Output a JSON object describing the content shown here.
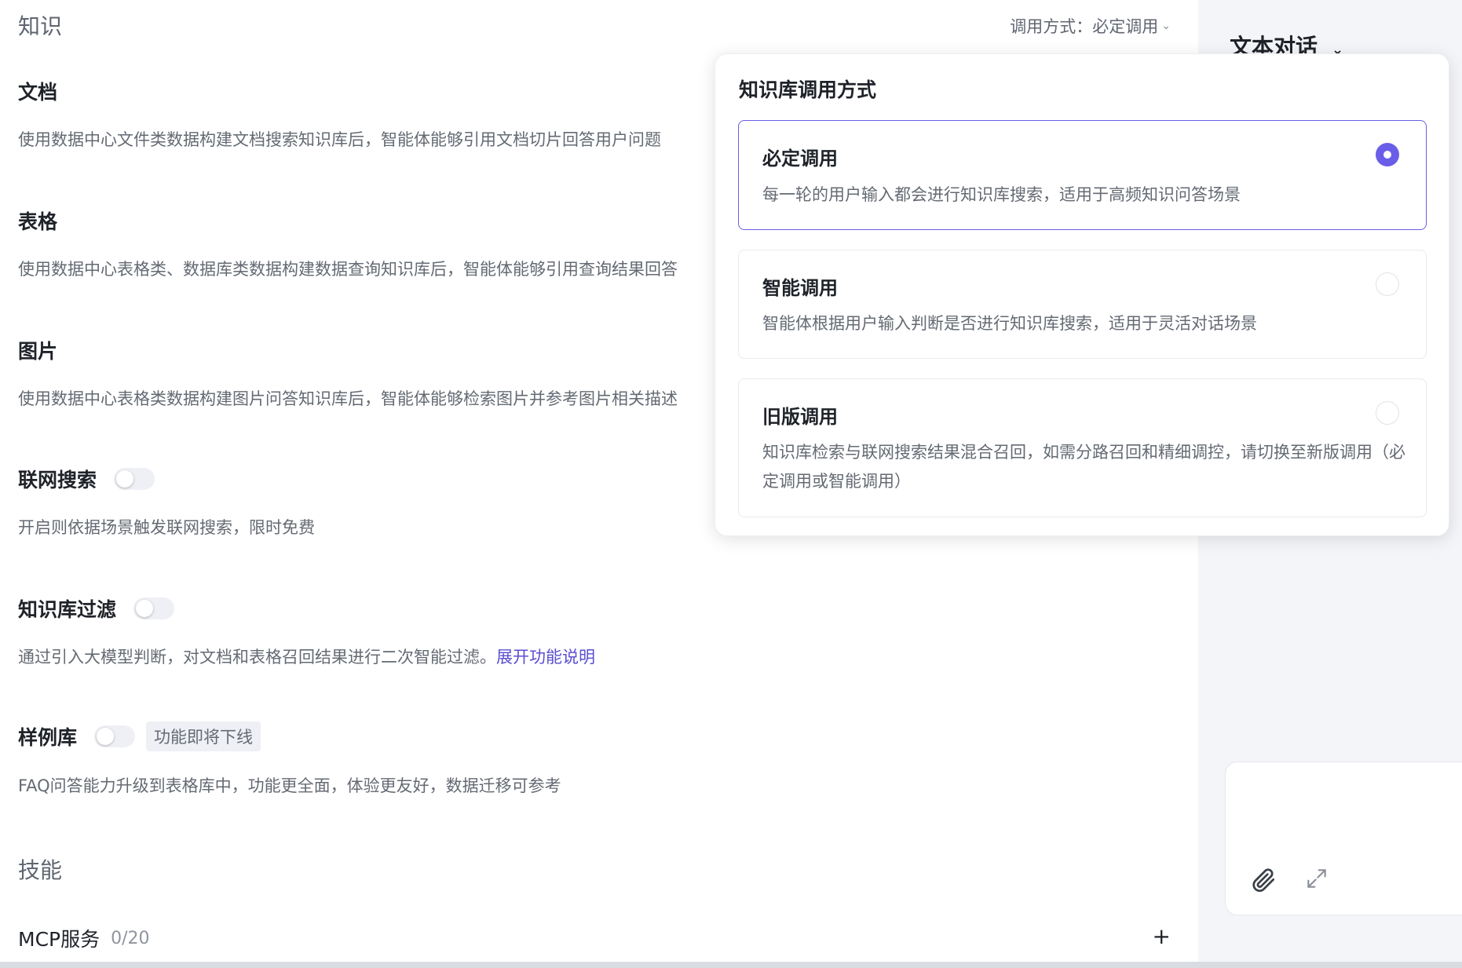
{
  "knowledge": {
    "section_title": "知识",
    "call_mode_label": "调用方式：必定调用",
    "call_mode_chevron": "chevron-down-icon",
    "document": {
      "title": "文档",
      "desc": "使用数据中心文件类数据构建文档搜索知识库后，智能体能够引用文档切片回答用户问题"
    },
    "table": {
      "title": "表格",
      "desc": "使用数据中心表格类、数据库类数据构建数据查询知识库后，智能体能够引用查询结果回答"
    },
    "image": {
      "title": "图片",
      "desc": "使用数据中心表格类数据构建图片问答知识库后，智能体能够检索图片并参考图片相关描述"
    },
    "web_search": {
      "title": "联网搜索",
      "toggle_on": false,
      "desc": "开启则依据场景触发联网搜索，限时免费"
    },
    "kb_filter": {
      "title": "知识库过滤",
      "toggle_on": false,
      "desc": "通过引入大模型判断，对文档和表格召回结果进行二次智能过滤。",
      "link": "展开功能说明"
    },
    "sample_lib": {
      "title": "样例库",
      "toggle_on": false,
      "tag": "功能即将下线",
      "desc": "FAQ问答能力升级到表格库中，功能更全面，体验更友好，数据迁移可参考"
    }
  },
  "skills": {
    "section_title": "技能",
    "mcp": {
      "title": "MCP服务",
      "count": "0/20",
      "add_icon": "plus-icon"
    }
  },
  "right_panel": {
    "title": "文本对话",
    "title_chevron": "chevron-down-icon",
    "attach_icon": "paperclip-icon",
    "expand_icon": "expand-icon"
  },
  "popup": {
    "title": "知识库调用方式",
    "options": [
      {
        "title": "必定调用",
        "desc": "每一轮的用户输入都会进行知识库搜索，适用于高频知识问答场景",
        "selected": true
      },
      {
        "title": "智能调用",
        "desc": "智能体根据用户输入判断是否进行知识库搜索，适用于灵活对话场景",
        "selected": false
      },
      {
        "title": "旧版调用",
        "desc": "知识库检索与联网搜索结果混合召回，如需分路召回和精细调控，请切换至新版调用（必定调用或智能调用）",
        "selected": false
      }
    ]
  },
  "colors": {
    "accent": "#6a5ee8",
    "link": "#5a4ed1",
    "right_bg": "#f4f5f8"
  }
}
